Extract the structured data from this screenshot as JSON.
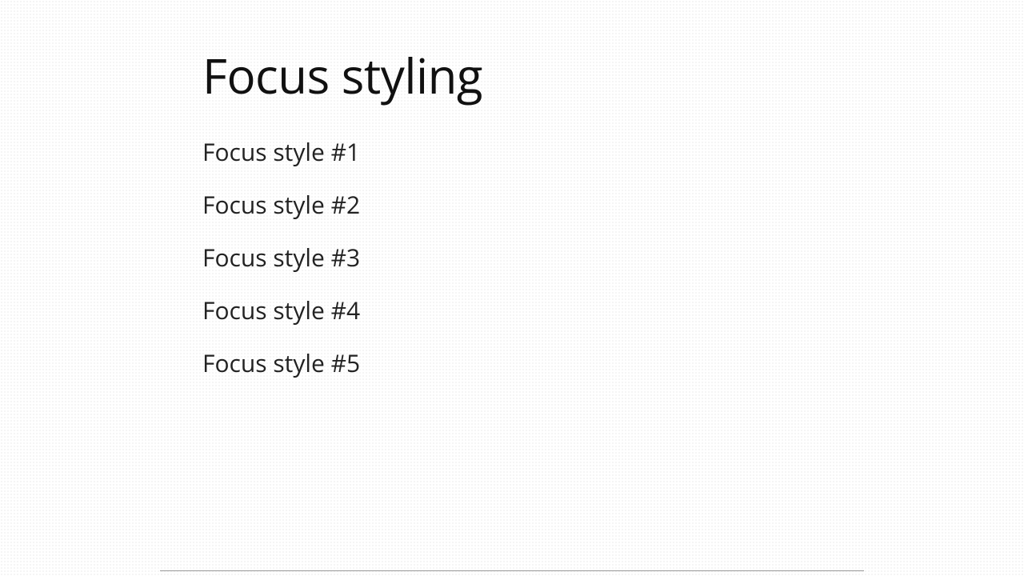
{
  "heading": "Focus styling",
  "links": {
    "0": {
      "label": "Focus style #1"
    },
    "1": {
      "label": "Focus style #2"
    },
    "2": {
      "label": "Focus style #3"
    },
    "3": {
      "label": "Focus style #4"
    },
    "4": {
      "label": "Focus style #5"
    }
  }
}
